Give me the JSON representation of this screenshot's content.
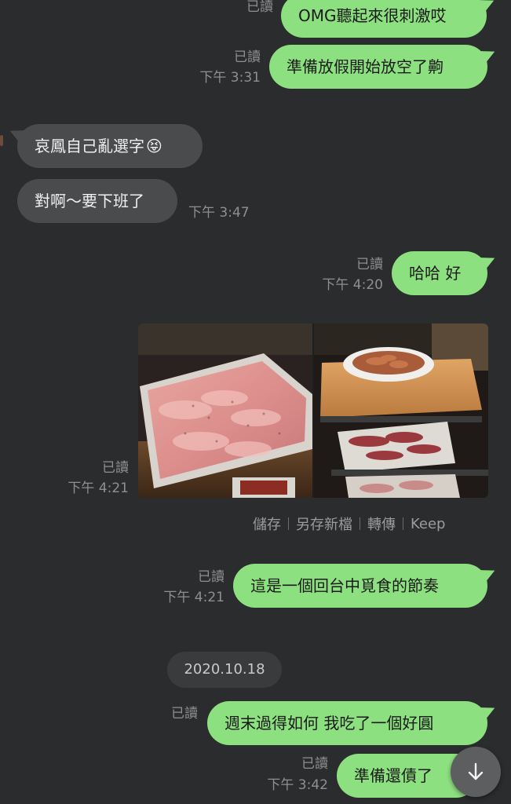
{
  "messages": [
    {
      "id": "m1",
      "text": "OMG聽起來很刺激哎",
      "read": "已讀",
      "time": ""
    },
    {
      "id": "m2",
      "text": "準備放假開始放空了齁",
      "read": "已讀",
      "time": "下午 3:31"
    },
    {
      "id": "m3",
      "text": "哀鳳自己亂選字",
      "emoji": "😝",
      "time": ""
    },
    {
      "id": "m4",
      "text": "對啊～要下班了",
      "time": "下午 3:47"
    },
    {
      "id": "m5",
      "text": "哈哈 好",
      "read": "已讀",
      "time": "下午 4:20"
    },
    {
      "id": "m6",
      "read": "已讀",
      "time": "下午 4:21"
    },
    {
      "id": "m7",
      "text": "這是一個回台中覓食的節奏",
      "read": "已讀",
      "time": "下午 4:21"
    },
    {
      "id": "m8",
      "text": "週末過得如何 我吃了一個好圓",
      "read": "已讀",
      "time": ""
    },
    {
      "id": "m9",
      "text": "準備還債了",
      "read": "已讀",
      "time": "下午 3:42"
    }
  ],
  "photo_actions": {
    "save": "儲存",
    "save_as": "另存新檔",
    "forward": "轉傳",
    "keep": "Keep"
  },
  "date_divider": "2020.10.18",
  "colors": {
    "background": "#2b2c2e",
    "my_bubble": "#8de07f",
    "their_bubble": "#4a4b4d",
    "meta_text": "#8e8f92"
  },
  "icons": {
    "scroll_down": "arrow-down-icon"
  }
}
